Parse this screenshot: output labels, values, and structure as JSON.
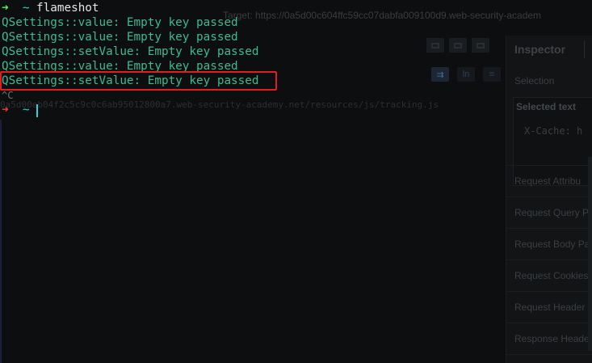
{
  "background_app": {
    "target_url": "Target: https://0a5d00c604ffc59cc07dabfa009100d9.web-security-academ",
    "faint_url": "0a5d00eb04f2c5c9c0c6ab95012800a7.web-security-academy.net/resources/js/tracking.js",
    "view_buttons": [
      "⇉",
      "ln",
      "≡"
    ],
    "inspector": {
      "title": "Inspector",
      "selection_label": "Selection",
      "selected_text_label": "Selected text",
      "selected_text_value": "X-Cache: h",
      "sections": [
        "Request Attribu",
        "Request Query P",
        "Request Body Pa",
        "Request Cookies",
        "Request Header",
        "Response Heade"
      ]
    }
  },
  "terminal": {
    "prompt_arrow": "➜",
    "prompt_dir": "~",
    "command": "flameshot",
    "output_lines": [
      "QSettings::value: Empty key passed",
      "QSettings::value: Empty key passed",
      "QSettings::setValue: Empty key passed",
      "QSettings::value: Empty key passed",
      "QSettings::setValue: Empty key passed"
    ],
    "interrupt": "^C"
  },
  "colors": {
    "output_green": "#3dbb8e",
    "highlight_red": "#e01e1e",
    "prompt_ok_green": "#5ef25e",
    "prompt_err_red": "#f23c3c",
    "dir_cyan": "#31d0d0"
  }
}
